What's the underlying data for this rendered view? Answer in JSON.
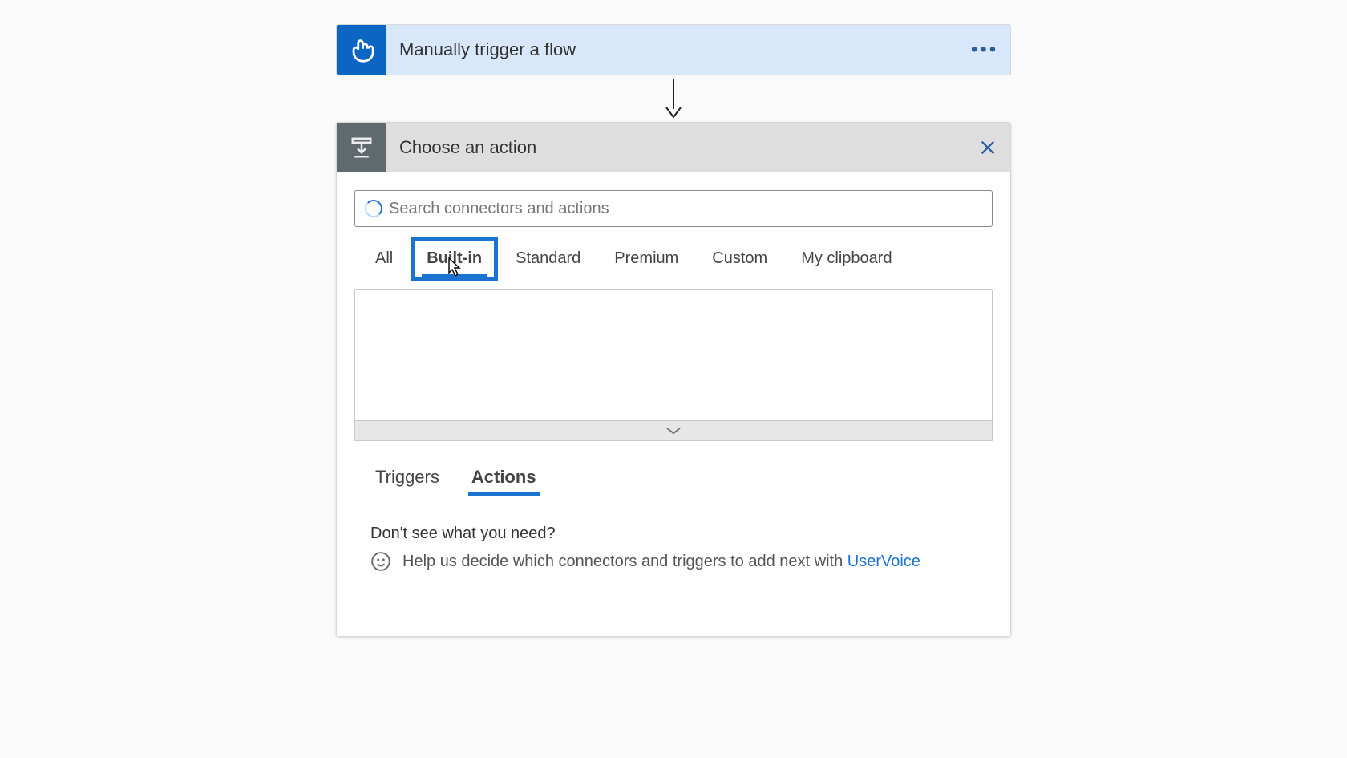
{
  "trigger": {
    "title": "Manually trigger a flow"
  },
  "chooser": {
    "title": "Choose an action",
    "search_placeholder": "Search connectors and actions"
  },
  "connector_tabs": {
    "all": "All",
    "builtin": "Built-in",
    "standard": "Standard",
    "premium": "Premium",
    "custom": "Custom",
    "myclipboard": "My clipboard"
  },
  "ta_tabs": {
    "triggers": "Triggers",
    "actions": "Actions"
  },
  "need": {
    "title": "Don't see what you need?",
    "help_text": "Help us decide which connectors and triggers to add next with ",
    "link": "UserVoice"
  }
}
